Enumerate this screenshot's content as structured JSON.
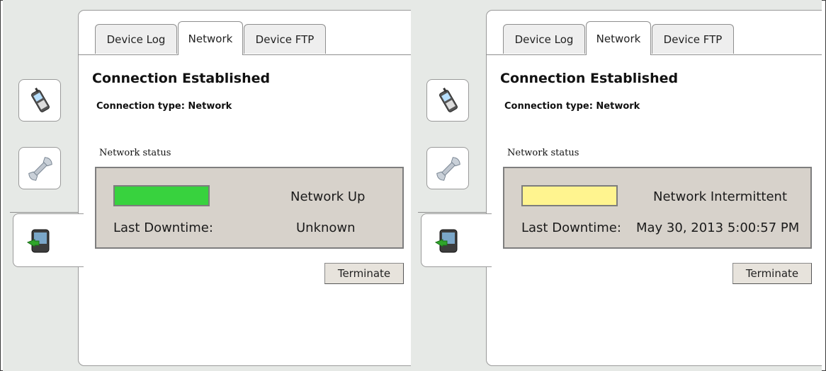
{
  "left": {
    "tabs": [
      {
        "label": "Device Log"
      },
      {
        "label": "Network"
      },
      {
        "label": "Device FTP"
      }
    ],
    "title": "Connection Established",
    "subtitle": "Connection type: Network",
    "status_label": "Network status",
    "status_color": "#38d23e",
    "status_value": "Network Up",
    "last_downtime_label": "Last Downtime:",
    "last_downtime_value": "Unknown",
    "terminate_label": "Terminate"
  },
  "right": {
    "tabs": [
      {
        "label": "Device Log"
      },
      {
        "label": "Network"
      },
      {
        "label": "Device FTP"
      }
    ],
    "title": "Connection Established",
    "subtitle": "Connection type: Network",
    "status_label": "Network status",
    "status_color": "#fff48f",
    "status_value": "Network Intermittent",
    "last_downtime_label": "Last Downtime:",
    "last_downtime_value": "May 30, 2013 5:00:57 PM",
    "terminate_label": "Terminate"
  },
  "icons": [
    "phone-icon",
    "wrench-icon",
    "pda-sync-icon"
  ]
}
